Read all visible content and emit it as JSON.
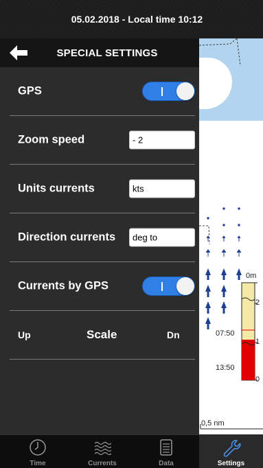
{
  "status_bar": {
    "text": "05.02.2018 - Local time 10:12"
  },
  "panel": {
    "title": "SPECIAL SETTINGS",
    "rows": [
      {
        "label": "GPS",
        "control": "toggle",
        "on": true
      },
      {
        "label": "Zoom speed",
        "control": "input",
        "value": "- 2"
      },
      {
        "label": "Units currents",
        "control": "input",
        "value": "kts"
      },
      {
        "label": "Direction currents",
        "control": "input",
        "value": "deg to"
      },
      {
        "label": "Currents by GPS",
        "control": "toggle",
        "on": true
      }
    ],
    "scale": {
      "up": "Up",
      "label": "Scale",
      "down": "Dn"
    }
  },
  "map": {
    "scale_label": "0,5 nm",
    "tide": {
      "axis_labels": [
        "2",
        "1",
        "0"
      ],
      "top_label": "0m",
      "times": [
        "07:50",
        "13:50"
      ]
    }
  },
  "tabs": [
    {
      "label": "Time",
      "icon": "clock-icon",
      "active": false
    },
    {
      "label": "Currents",
      "icon": "waves-icon",
      "active": false
    },
    {
      "label": "Data",
      "icon": "document-icon",
      "active": false
    },
    {
      "label": "Settings",
      "icon": "wrench-icon",
      "active": true
    }
  ],
  "colors": {
    "toggle_on": "#2f7fe6",
    "water": "#b3d4ee",
    "current_arrow": "#1f3f8f",
    "tide_fill": "#f5e9a8",
    "tide_level": "#e00000"
  }
}
